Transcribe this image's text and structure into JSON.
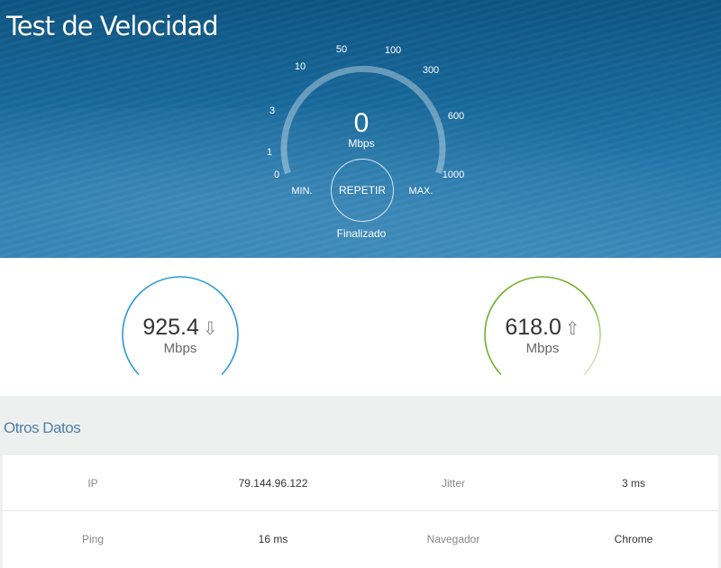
{
  "header": {
    "title": "Test de Velocidad"
  },
  "gauge": {
    "ticks": [
      "0",
      "1",
      "3",
      "10",
      "50",
      "100",
      "300",
      "600",
      "1000"
    ],
    "value": "0",
    "unit": "Mbps",
    "min_label": "MIN.",
    "max_label": "MAX.",
    "repeat_label": "REPETIR",
    "status": "Finalizado",
    "arc_color": "#ffffff"
  },
  "results": {
    "download": {
      "value": "925.4",
      "unit": "Mbps",
      "icon": "download-arrow-icon",
      "color": "#2a9ad6"
    },
    "upload": {
      "value": "618.0",
      "unit": "Mbps",
      "icon": "upload-arrow-icon",
      "color": "#6fb02b"
    }
  },
  "other_data": {
    "title": "Otros Datos",
    "rows": [
      {
        "label1": "IP",
        "value1": "79.144.96.122",
        "label2": "Jitter",
        "value2": "3 ms"
      },
      {
        "label1": "Ping",
        "value1": "16 ms",
        "label2": "Navegador",
        "value2": "Chrome"
      }
    ]
  }
}
